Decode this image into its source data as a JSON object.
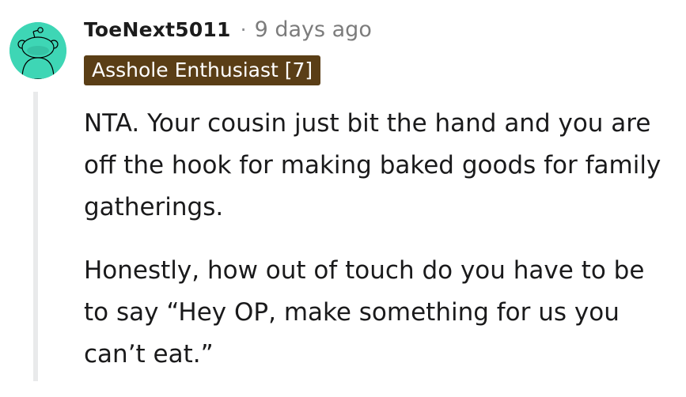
{
  "comment": {
    "avatar": {
      "icon": "reddit-snoo-avatar-icon",
      "background_color": "#3ed6b5"
    },
    "username": "ToeNext5011",
    "separator": "·",
    "timestamp": "9 days ago",
    "flair": {
      "text": "Asshole Enthusiast [7]",
      "background_color": "#5a3e16"
    },
    "body_paragraphs": [
      "NTA. Your cousin just bit the hand and you are off the hook for making baked goods for family gatherings.",
      "Honestly, how out of touch do you have to be to say “Hey OP, make something for us you can’t eat.”"
    ]
  }
}
